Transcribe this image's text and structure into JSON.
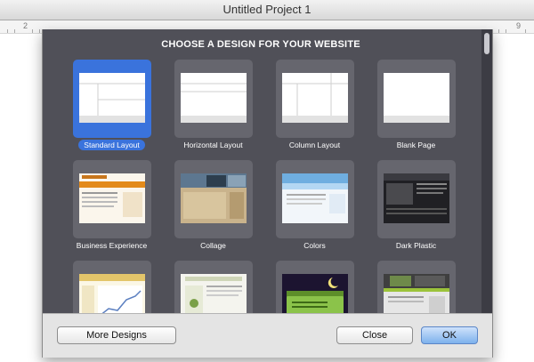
{
  "window": {
    "title": "Untitled Project 1"
  },
  "ruler": {
    "left_mark": "2",
    "right_mark": "9"
  },
  "chooser": {
    "heading": "CHOOSE A DESIGN FOR YOUR WEBSITE",
    "items": [
      {
        "label": "Standard Layout",
        "selected": true
      },
      {
        "label": "Horizontal Layout",
        "selected": false
      },
      {
        "label": "Column Layout",
        "selected": false
      },
      {
        "label": "Blank Page",
        "selected": false
      },
      {
        "label": "Business Experience",
        "selected": false
      },
      {
        "label": "Collage",
        "selected": false
      },
      {
        "label": "Colors",
        "selected": false
      },
      {
        "label": "Dark Plastic",
        "selected": false
      },
      {
        "label": "",
        "selected": false
      },
      {
        "label": "",
        "selected": false
      },
      {
        "label": "",
        "selected": false
      },
      {
        "label": "",
        "selected": false
      }
    ]
  },
  "buttons": {
    "more_designs": "More Designs",
    "close": "Close",
    "ok": "OK"
  },
  "colors": {
    "selection": "#3a73dc",
    "chooser_bg": "#505058",
    "tile_bg": "#66666e"
  }
}
